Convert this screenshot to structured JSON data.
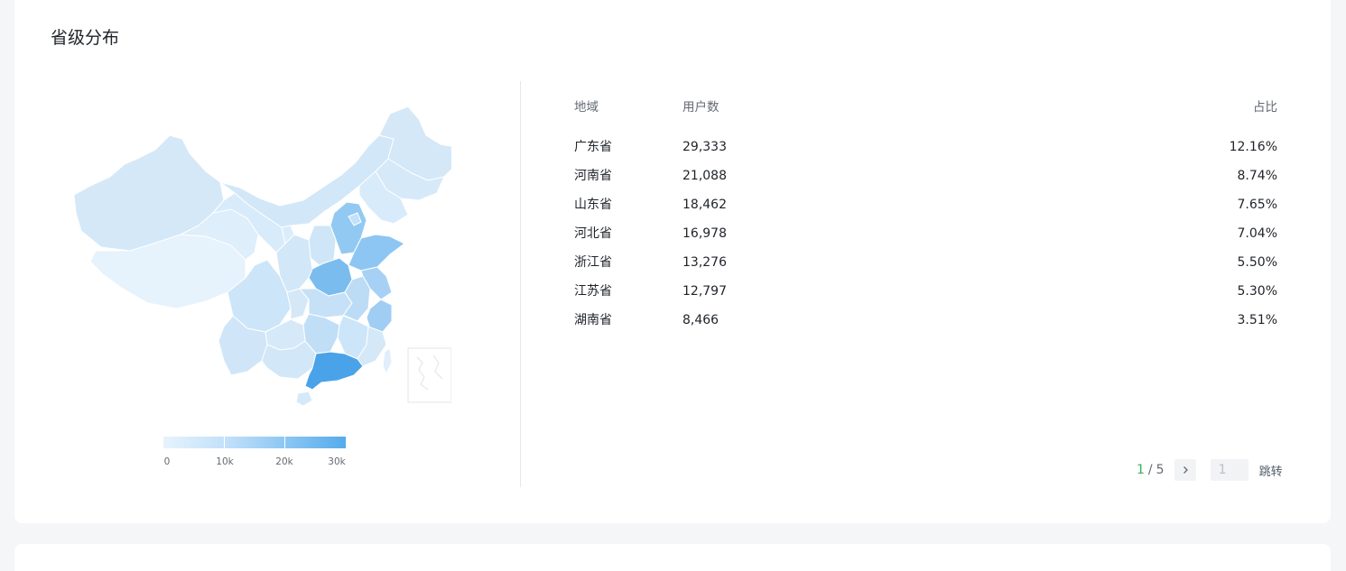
{
  "section": {
    "title": "省级分布"
  },
  "legend": {
    "colors": [
      "#e6f3fd",
      "#c3e1fa",
      "#8cc7f4",
      "#55abec"
    ],
    "labels": [
      "0",
      "10k",
      "20k",
      "30k"
    ]
  },
  "table": {
    "headers": {
      "region": "地域",
      "users": "用户数",
      "ratio": "占比"
    },
    "rows": [
      {
        "region": "广东省",
        "users": "29,333",
        "ratio": "12.16%"
      },
      {
        "region": "河南省",
        "users": "21,088",
        "ratio": "8.74%"
      },
      {
        "region": "山东省",
        "users": "18,462",
        "ratio": "7.65%"
      },
      {
        "region": "河北省",
        "users": "16,978",
        "ratio": "7.04%"
      },
      {
        "region": "浙江省",
        "users": "13,276",
        "ratio": "5.50%"
      },
      {
        "region": "江苏省",
        "users": "12,797",
        "ratio": "5.30%"
      },
      {
        "region": "湖南省",
        "users": "8,466",
        "ratio": "3.51%"
      }
    ]
  },
  "pagination": {
    "current": "1",
    "separator": "/",
    "total": "5",
    "jump_placeholder": "1",
    "jump_label": "跳转"
  },
  "colors": {
    "accent_green": "#33b25d",
    "map_high": "#4aa3e8",
    "map_low": "#e8f3fc"
  }
}
